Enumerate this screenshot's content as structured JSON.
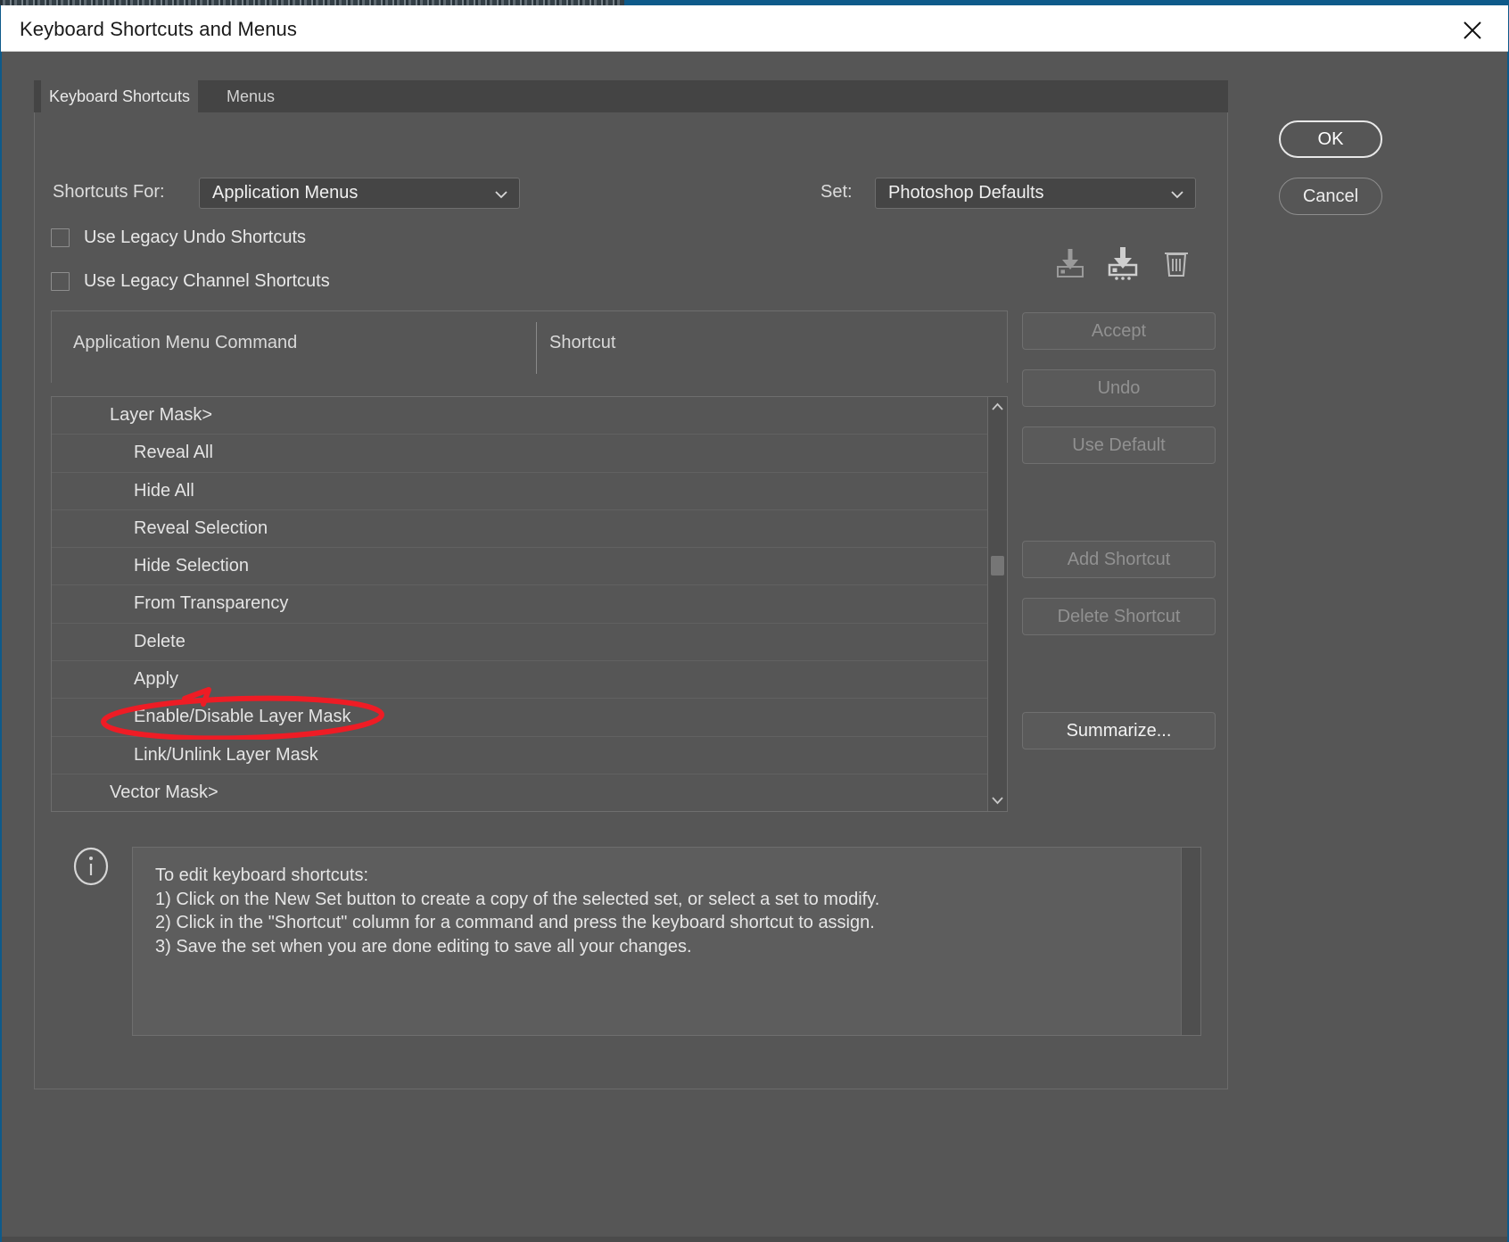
{
  "window": {
    "title": "Keyboard Shortcuts and Menus",
    "close_icon": "close-icon"
  },
  "tabs": [
    {
      "label": "Keyboard Shortcuts",
      "active": true
    },
    {
      "label": "Menus",
      "active": false
    }
  ],
  "controls": {
    "shortcuts_for_label": "Shortcuts For:",
    "shortcuts_for_value": "Application Menus",
    "set_label": "Set:",
    "set_value": "Photoshop Defaults",
    "chevron_icon": "chevron-down-icon"
  },
  "checkboxes": [
    {
      "label": "Use Legacy Undo Shortcuts",
      "checked": false
    },
    {
      "label": "Use Legacy Channel Shortcuts",
      "checked": false
    }
  ],
  "set_icons": [
    {
      "name": "save-set-icon",
      "title": "Save Set"
    },
    {
      "name": "save-set-as-icon",
      "title": "Save Set As"
    },
    {
      "name": "delete-set-icon",
      "title": "Delete Set"
    }
  ],
  "table": {
    "columns": [
      "Application Menu Command",
      "Shortcut"
    ],
    "rows": [
      {
        "command": "Layer Mask>",
        "shortcut": "",
        "level": 1,
        "highlighted": false
      },
      {
        "command": "Reveal All",
        "shortcut": "",
        "level": 2,
        "highlighted": false
      },
      {
        "command": "Hide All",
        "shortcut": "",
        "level": 2,
        "highlighted": false
      },
      {
        "command": "Reveal Selection",
        "shortcut": "",
        "level": 2,
        "highlighted": false
      },
      {
        "command": "Hide Selection",
        "shortcut": "",
        "level": 2,
        "highlighted": false
      },
      {
        "command": "From Transparency",
        "shortcut": "",
        "level": 2,
        "highlighted": false
      },
      {
        "command": "Delete",
        "shortcut": "",
        "level": 2,
        "highlighted": false
      },
      {
        "command": "Apply",
        "shortcut": "",
        "level": 2,
        "highlighted": false
      },
      {
        "command": "Enable/Disable Layer Mask",
        "shortcut": "",
        "level": 2,
        "highlighted": true
      },
      {
        "command": "Link/Unlink Layer Mask",
        "shortcut": "",
        "level": 2,
        "highlighted": false
      },
      {
        "command": "Vector Mask>",
        "shortcut": "",
        "level": 1,
        "highlighted": false
      }
    ]
  },
  "scrollbar": {
    "up_icon": "chevron-up-icon",
    "down_icon": "chevron-down-icon"
  },
  "side_buttons": [
    {
      "label": "Accept",
      "enabled": false
    },
    {
      "label": "Undo",
      "enabled": false
    },
    {
      "label": "Use Default",
      "enabled": false
    },
    {
      "label": "Add Shortcut",
      "enabled": false
    },
    {
      "label": "Delete Shortcut",
      "enabled": false
    },
    {
      "label": "Summarize...",
      "enabled": true
    }
  ],
  "info": {
    "icon": "info-circle-icon",
    "text": "To edit keyboard shortcuts:\n1) Click on the New Set button to create a copy of the selected set, or select a set to modify.\n2) Click in the \"Shortcut\" column for a command and press the keyboard shortcut to assign.\n3) Save the set when you are done editing to save all your changes."
  },
  "primary_buttons": [
    {
      "label": "OK",
      "primary": true
    },
    {
      "label": "Cancel",
      "primary": false
    }
  ],
  "annotation": {
    "shape": "red-ellipse-with-arrow",
    "color": "#ee1c25",
    "targets": "Enable/Disable Layer Mask"
  },
  "colors": {
    "dialog_bg": "#565656",
    "titlebar_bg": "#ffffff",
    "tab_strip_bg": "#444444",
    "field_bg": "#454545",
    "accent_blue": "#0e5a8a",
    "annotation_red": "#ee1c25"
  }
}
